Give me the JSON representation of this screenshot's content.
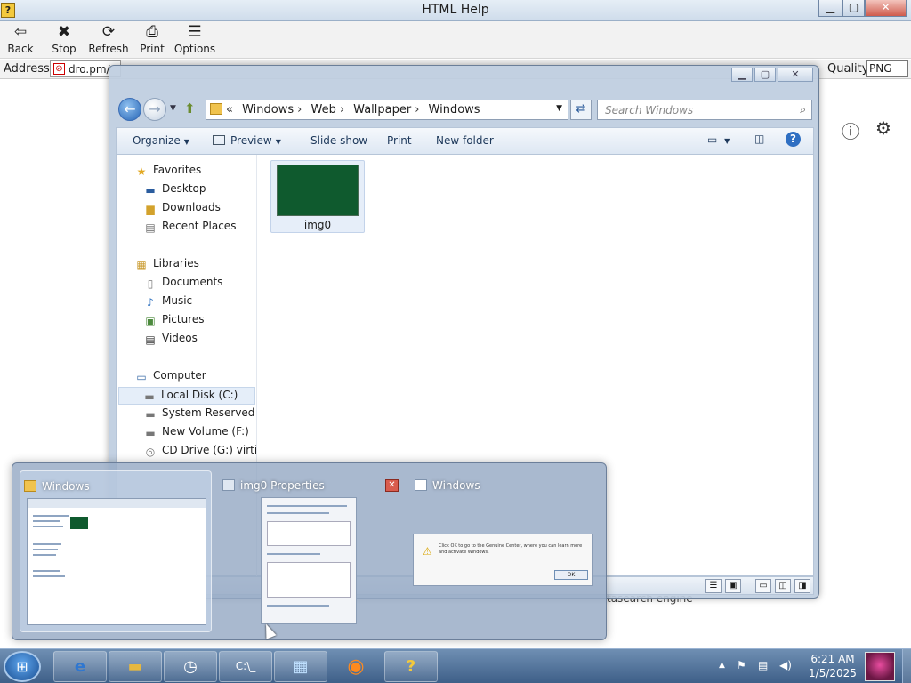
{
  "help_window": {
    "title": "HTML Help",
    "toolbar": [
      {
        "label": "Back",
        "icon": "back-arrow-icon",
        "glyph": "⇦"
      },
      {
        "label": "Stop",
        "icon": "stop-icon",
        "glyph": "✖"
      },
      {
        "label": "Refresh",
        "icon": "refresh-icon",
        "glyph": "⟳"
      },
      {
        "label": "Print",
        "icon": "print-icon",
        "glyph": "⎙"
      },
      {
        "label": "Options",
        "icon": "options-icon",
        "glyph": "☰"
      }
    ],
    "address_label": "Address",
    "address_value": "dro.pm/",
    "quality_label": "Quality",
    "quality_value": "PNG",
    "background_text": "tasearch engine"
  },
  "explorer": {
    "breadcrumb": [
      "Windows",
      "Web",
      "Wallpaper",
      "Windows"
    ],
    "breadcrumb_prefix": "«",
    "search_placeholder": "Search Windows",
    "commands": [
      "Organize",
      "Preview",
      "Slide show",
      "Print",
      "New folder"
    ],
    "nav": {
      "favorites_label": "Favorites",
      "favorites": [
        "Desktop",
        "Downloads",
        "Recent Places"
      ],
      "libraries_label": "Libraries",
      "libraries": [
        "Documents",
        "Music",
        "Pictures",
        "Videos"
      ],
      "computer_label": "Computer",
      "computer": [
        "Local Disk (C:)",
        "System Reserved (E:)",
        "New Volume (F:)",
        "CD Drive (G:) virtio-v"
      ]
    },
    "files": [
      {
        "name": "img0"
      }
    ]
  },
  "switcher": {
    "items": [
      {
        "title": "Windows"
      },
      {
        "title": "img0 Properties"
      },
      {
        "title": "Windows",
        "dialog_text": "Click OK to go to the Genuine Center, where you can learn more and activate Windows.",
        "ok_label": "OK"
      }
    ]
  },
  "taskbar": {
    "time": "6:21 AM",
    "date": "1/5/2025",
    "icons": [
      "start-orb-icon",
      "internet-explorer-icon",
      "file-explorer-icon",
      "scheduler-icon",
      "command-prompt-icon",
      "control-panel-icon",
      "firefox-icon",
      "html-help-icon"
    ]
  },
  "colors": {
    "taskbar": "#4a6b93",
    "explorer_frame": "#becde0",
    "accent": "#2766b6"
  }
}
